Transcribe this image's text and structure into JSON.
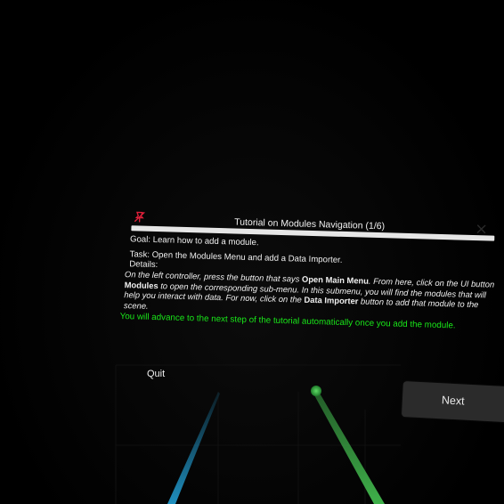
{
  "tutorial": {
    "title": "Tutorial on Modules Navigation (1/6)",
    "goal": "Goal: Learn how to add a module.",
    "task": "Task: Open the Modules Menu and add a Data Importer.",
    "details_label": "Details:",
    "details": {
      "part1": "On the left controller, press the button that says ",
      "open_main_menu": "Open Main Menu",
      "part2": ". From here, click on the UI button ",
      "modules": "Modules",
      "part3": " to open the corresponding sub-menu. In this submenu, you will find the modules that will help you interact with data. For now, click on the ",
      "data_importer": "Data Importer",
      "part4": " button to add that module to the scene."
    },
    "advance_note": "You will advance to the next step of the tutorial automatically once you add the module."
  },
  "quit_label": "Quit",
  "next_label": "Next",
  "colors": {
    "note_green": "#19e619",
    "pin_red": "#e0203a",
    "left_ray": "#1f8fbf",
    "right_ray": "#3fb04a"
  },
  "icons": {
    "pin": "pin-icon",
    "close": "close-icon"
  }
}
